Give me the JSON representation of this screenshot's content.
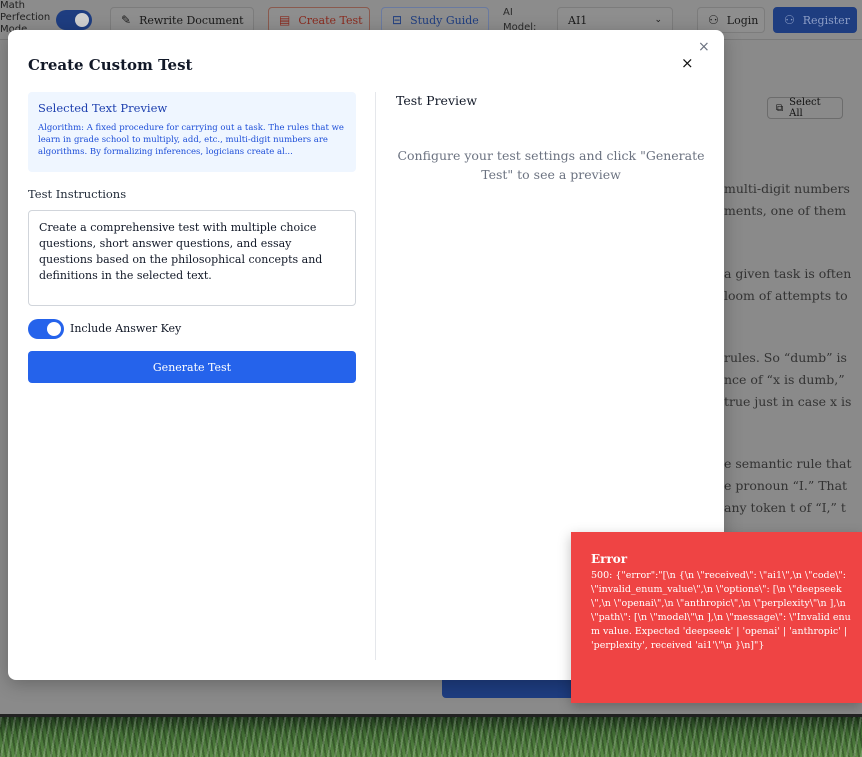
{
  "header": {
    "math_label": "Math Perfection Mode",
    "rewrite_label": "Rewrite Document",
    "create_test_label": "Create Test",
    "study_guide_label": "Study Guide",
    "ai_model_label": "AI Model:",
    "ai_model_value": "AI1",
    "login_label": "Login",
    "register_label": "Register"
  },
  "background": {
    "select_all_label": "Select All",
    "text_lines": [
      "multi-digit numbers",
      "ments, one of them",
      "a given task is often",
      "loom of attempts to",
      "rules. So “dumb” is",
      "nce of “x is dumb,”",
      "true just in case x is",
      "e semantic rule that",
      "e pronoun “I.” That",
      "any token t of “I,” t"
    ]
  },
  "modal": {
    "title": "Create Custom Test",
    "close_outer": "×",
    "close_inner": "×",
    "preview_title": "Selected Text Preview",
    "preview_text": "Algorithm: A fixed procedure for carrying out a task. The rules that we learn in grade school to multiply, add, etc., multi-digit numbers are algorithms. By formalizing inferences, logicians create al...",
    "instructions_label": "Test Instructions",
    "instructions_value": "Create a comprehensive test with multiple choice questions, short answer questions, and essay questions based on the philosophical concepts and definitions in the selected text.",
    "answer_key_label": "Include Answer Key",
    "answer_key_on": true,
    "generate_label": "Generate Test",
    "test_preview_title": "Test Preview",
    "test_preview_message": "Configure your test settings and click \"Generate Test\" to see a preview"
  },
  "toast": {
    "title": "Error",
    "message": "500: {\"error\":\"[\\n {\\n \\\"received\\\": \\\"ai1\\\",\\n \\\"code\\\": \\\"invalid_enum_value\\\",\\n \\\"options\\\": [\\n \\\"deepseek\\\",\\n \\\"openai\\\",\\n \\\"anthropic\\\",\\n \\\"perplexity\\\"\\n ],\\n \\\"path\\\": [\\n \\\"model\\\"\\n ],\\n \\\"message\\\": \\\"Invalid enum value. Expected 'deepseek' | 'openai' | 'anthropic' | 'perplexity', received 'ai1'\\\"\\n }\\n]\"}"
  },
  "colors": {
    "primary": "#2563eb",
    "error": "#ef4444",
    "preview_bg": "#eff6ff",
    "create_test_accent": "#dc2626"
  }
}
